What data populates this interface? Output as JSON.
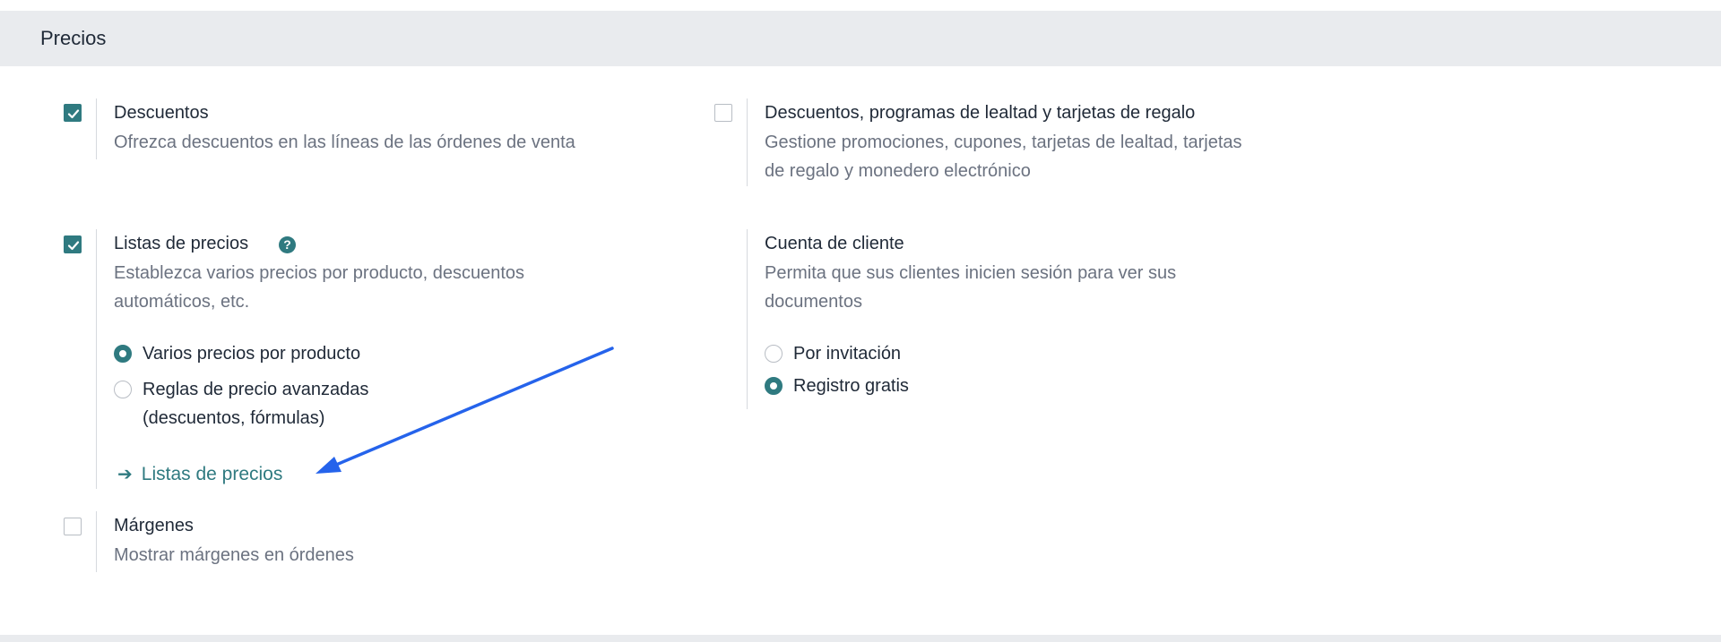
{
  "section": {
    "title": "Precios"
  },
  "settings": {
    "discounts": {
      "title": "Descuentos",
      "description": "Ofrezca descuentos en las líneas de las órdenes de venta",
      "checked": true
    },
    "loyalty": {
      "title": "Descuentos, programas de lealtad y tarjetas de regalo",
      "description_line1": "Gestione promociones, cupones, tarjetas de lealtad, tarjetas",
      "description_line2": "de regalo y monedero electrónico",
      "checked": false
    },
    "pricelists": {
      "title": "Listas de precios",
      "help_glyph": "?",
      "description_line1": "Establezca varios precios por producto, descuentos",
      "description_line2": "automáticos, etc.",
      "checked": true,
      "options": [
        {
          "label": "Varios precios por producto",
          "selected": true
        },
        {
          "label_line1": "Reglas de precio avanzadas",
          "label_line2": "(descuentos, fórmulas)",
          "selected": false
        }
      ],
      "link_arrow": "➔",
      "link_label": "Listas de precios"
    },
    "customer_account": {
      "title": "Cuenta de cliente",
      "description_line1": "Permita que sus clientes inicien sesión para ver sus",
      "description_line2": "documentos",
      "options": [
        {
          "label": "Por invitación",
          "selected": false
        },
        {
          "label": "Registro gratis",
          "selected": true
        }
      ]
    },
    "margins": {
      "title": "Márgenes",
      "description": "Mostrar márgenes en órdenes",
      "checked": false
    }
  },
  "colors": {
    "accent": "#2f7a80",
    "annotation_arrow": "#2563eb",
    "header_bg": "#e9ebee"
  },
  "icons": {
    "checkbox_checked": "check-icon",
    "help": "question-circle-icon",
    "link": "arrow-right-icon",
    "annotation": "annotation-arrow-icon"
  }
}
